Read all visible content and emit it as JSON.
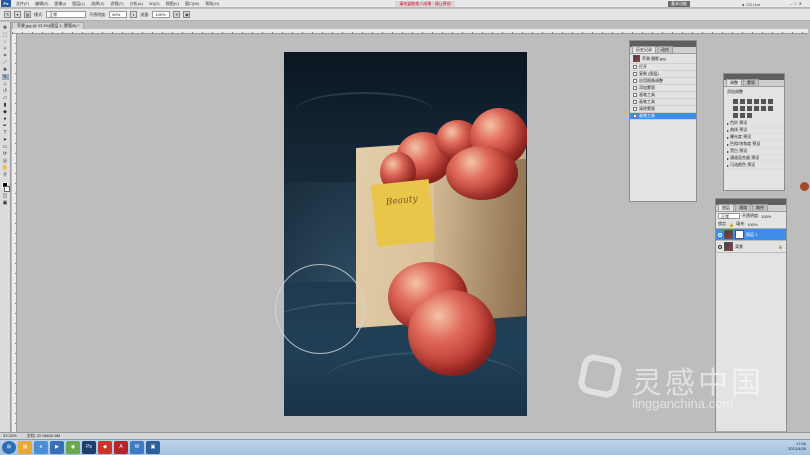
{
  "menubar": {
    "logo": "Ps",
    "items": [
      "文件(F)",
      "编辑(E)",
      "图像(I)",
      "图层(L)",
      "选择(S)",
      "滤镜(T)",
      "分析(A)",
      "3D(D)",
      "视图(V)",
      "窗口(W)",
      "帮助(H)"
    ],
    "notice": "请勿盗取他人成果 · 请让原创",
    "workspace": "基本功能",
    "cs_live": "CS Live"
  },
  "options": {
    "mode_label": "模式:",
    "mode_value": "正常",
    "opacity_label": "不透明度:",
    "opacity_value": "60%",
    "flow_label": "流量:",
    "flow_value": "100%"
  },
  "document": {
    "tab_title": "苹果.jpg @ 33.3%(图层 1, 蒙版/8) *"
  },
  "photo": {
    "bag_label_text": "Beauty"
  },
  "history_panel": {
    "tabs": [
      "历史记录",
      "动作"
    ],
    "snapshot": "苹果 摄影.jpg",
    "items": [
      "打开",
      "复制 (图层)",
      "应用图像调整",
      "添加蒙版",
      "画笔工具",
      "画笔工具",
      "清除蒙版",
      "画笔工具"
    ]
  },
  "adjust_panel": {
    "tabs": [
      "调整",
      "蒙版"
    ],
    "title": "添加调整",
    "presets": [
      "色阶 预设",
      "曲线 预设",
      "曝光度 预设",
      "色相/饱和度 预设",
      "黑白 预设",
      "通道混合器 预设",
      "可选颜色 预设"
    ]
  },
  "layers_panel": {
    "tabs": [
      "图层",
      "通道",
      "路径"
    ],
    "blend_mode": "正常",
    "opacity_label": "不透明度:",
    "opacity_value": "100%",
    "lock_label": "锁定:",
    "fill_label": "填充:",
    "fill_value": "100%",
    "layers": [
      {
        "name": "图层 1",
        "selected": true
      },
      {
        "name": "背景",
        "selected": false
      }
    ]
  },
  "statusbar": {
    "zoom": "33.33%",
    "doc_info": "文档: 22.9M/45.8M"
  },
  "taskbar": {
    "tray_time": "17:56",
    "tray_date": "2012/4/26"
  },
  "watermark": {
    "chinese": "灵感中国",
    "url": "lingganchina.com"
  },
  "colors": {
    "selection": "#3d8ee6",
    "notice_red": "#d0021b"
  }
}
